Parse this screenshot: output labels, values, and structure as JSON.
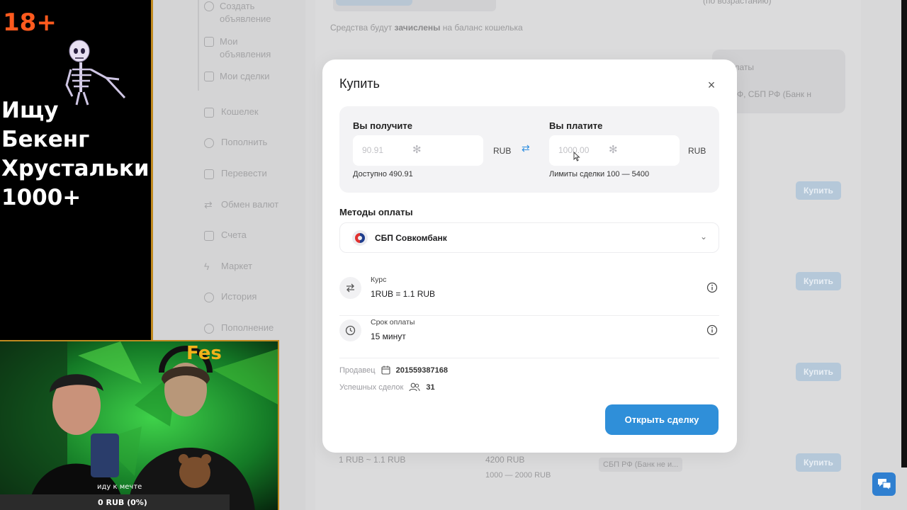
{
  "background": {
    "sidebar_sub_items": [
      "Создать объявление",
      "Мои объявления",
      "Мои сделки"
    ],
    "sidebar_items": [
      "Кошелек",
      "Пополнить",
      "Перевести",
      "Обмен валют",
      "Счета",
      "Маркет",
      "История",
      "Пополнение"
    ],
    "credit_note_prefix": "Средства будут ",
    "credit_note_bold": "зачислены",
    "credit_note_suffix": " на баланс кошелька",
    "top_right_note": "(по возрастанию)",
    "filter_label": "платы",
    "filter_value": "Ф, СБП РФ (Банк н",
    "buy_label": "Купить",
    "listing_rate": "1 RUB ~ 1.1 RUB",
    "listing_amount": "4200 RUB",
    "listing_limits": "1000 — 2000 RUB",
    "listing_method": "СБП РФ (Банк не и..."
  },
  "modal": {
    "title": "Купить",
    "close_symbol": "×",
    "receive": {
      "label": "Вы получите",
      "value": "90.91",
      "currency": "RUB",
      "note": "Доступно 490.91"
    },
    "pay": {
      "label": "Вы платите",
      "value": "1000.00",
      "currency": "RUB",
      "note": "Лимиты сделки 100 — 5400"
    },
    "swap_symbol": "⇄",
    "spinner_symbol": "✻",
    "methods_title": "Методы оплаты",
    "method_selected": "СБП Совкомбанк",
    "chevron_symbol": "⌄",
    "rate_label": "Курс",
    "rate_value": "1RUB = 1.1 RUB",
    "term_label": "Срок оплаты",
    "term_value": "15 минут",
    "seller_label": "Продавец",
    "seller_value": "201559387168",
    "deals_label": "Успешных сделок",
    "deals_value": "31",
    "open_deal_button": "Открыть сделку"
  },
  "overlay": {
    "age_badge": "18+",
    "promo_line1": "Ищу Бекенг",
    "promo_line2": "Хрустальки",
    "promo_line3": "1000+",
    "webcam_name": "Fes",
    "webcam_caption": "иду к мечте",
    "donation_text": "0 RUB (0%)"
  },
  "colors": {
    "accent": "#2f8fd9",
    "age_badge": "#ff5a1e",
    "webcam_name": "#f2b21a",
    "frame": "#c08a20"
  },
  "icons": [
    "swap-icon",
    "spinner-icon",
    "bank-logo-icon",
    "chevron-down-icon",
    "exchange-rate-icon",
    "clock-icon",
    "info-icon",
    "calendar-icon",
    "users-icon",
    "close-icon",
    "chat-icon",
    "skeleton-icon"
  ]
}
